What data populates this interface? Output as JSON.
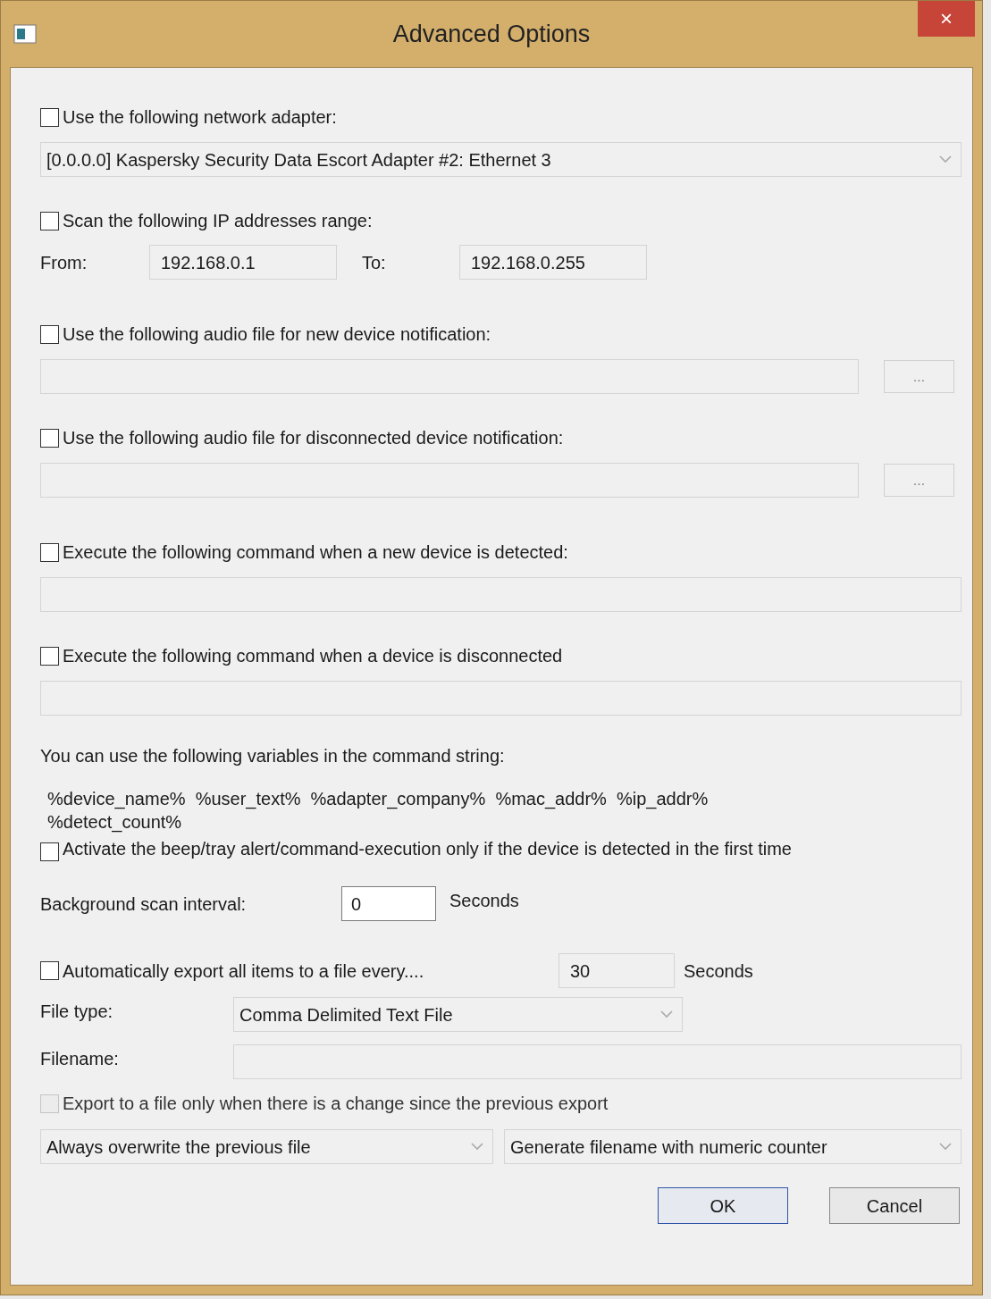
{
  "window": {
    "title": "Advanced Options",
    "close": "×"
  },
  "adapter": {
    "checkbox": {
      "label": "Use the following network adapter:",
      "checked": false
    },
    "dropdown": {
      "value": "[0.0.0.0]  Kaspersky Security Data Escort Adapter #2:  Ethernet 3",
      "disabled": true
    }
  },
  "ip_range": {
    "checkbox": {
      "label": "Scan the following IP addresses range:",
      "checked": false
    },
    "from_label": "From:",
    "from": {
      "value": "192.168.0.1",
      "disabled": true
    },
    "to_label": "To:",
    "to": {
      "value": "192.168.0.255",
      "disabled": true
    }
  },
  "audio_new": {
    "checkbox": {
      "label": "Use the following audio file for new device notification:",
      "checked": false
    },
    "field": {
      "disabled": true
    },
    "browse": "..."
  },
  "audio_disconnected": {
    "checkbox": {
      "label": "Use the following audio file for disconnected device notification:",
      "checked": false
    },
    "field": {
      "disabled": true
    },
    "browse": "..."
  },
  "command_new": {
    "checkbox": {
      "label": "Execute the following command when a new device is detected:",
      "checked": false
    },
    "field": {
      "disabled": true
    }
  },
  "command_disconnected": {
    "checkbox": {
      "label": "Execute the following command when a device is disconnected",
      "checked": false
    },
    "field": {
      "disabled": true
    }
  },
  "variables_hint": "You can use the following variables in the command string:",
  "variables": "%device_name%  %user_text%  %adapter_company%  %mac_addr%  %ip_addr%  %detect_count%",
  "first_time": {
    "label": "Activate the beep/tray alert/command-execution only if the device is detected in the first time",
    "checked": false
  },
  "scan_interval": {
    "label": "Background scan interval:",
    "value": "0",
    "disabled": false,
    "unit": "Seconds"
  },
  "auto_export": {
    "checkbox": {
      "label": "Automatically export all items to a file every....",
      "checked": false
    },
    "value": "30",
    "disabled": true,
    "unit": "Seconds"
  },
  "file_type": {
    "label": "File type:",
    "value": "Comma Delimited Text File",
    "disabled": true
  },
  "filename": {
    "label": "Filename:",
    "disabled": true
  },
  "export_on_change": {
    "label": "Export to a file only when there is a change since the previous export",
    "checked": false,
    "disabled": true
  },
  "overwrite": {
    "value": "Always overwrite the previous file",
    "disabled": true
  },
  "naming": {
    "value": "Generate filename with numeric counter",
    "disabled": true
  },
  "buttons": [
    {
      "label": "OK",
      "default": true
    },
    {
      "label": "Cancel",
      "default": false
    }
  ]
}
